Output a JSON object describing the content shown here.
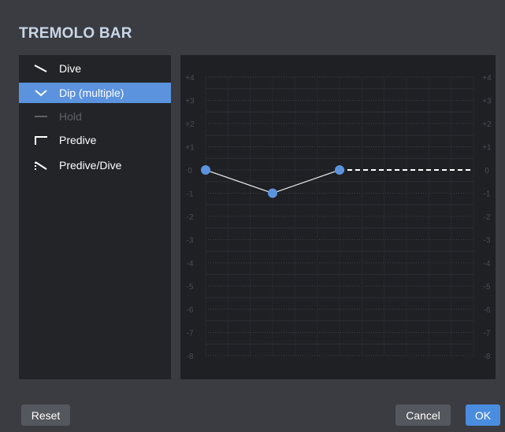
{
  "dialog": {
    "title": "TREMOLO BAR"
  },
  "types": [
    {
      "label": "Dive",
      "icon": "dive-icon",
      "selected": false,
      "disabled": false
    },
    {
      "label": "Dip (multiple)",
      "icon": "dip-icon",
      "selected": true,
      "disabled": false
    },
    {
      "label": "Hold",
      "icon": "hold-icon",
      "selected": false,
      "disabled": true
    },
    {
      "label": "Predive",
      "icon": "predive-icon",
      "selected": false,
      "disabled": false
    },
    {
      "label": "Predive/Dive",
      "icon": "predive-dive-icon",
      "selected": false,
      "disabled": false
    }
  ],
  "chart_data": {
    "type": "line",
    "y_ticks": [
      "+4",
      "+3",
      "+2",
      "+1",
      "0",
      "-1",
      "-2",
      "-3",
      "-4",
      "-5",
      "-6",
      "-7",
      "-8"
    ],
    "ylim": [
      -8,
      4
    ],
    "x_steps": 12,
    "series": [
      {
        "points": [
          [
            0,
            0
          ],
          [
            3,
            -1
          ],
          [
            6,
            0
          ]
        ]
      }
    ],
    "hold_line": {
      "from": [
        6,
        0
      ],
      "to": [
        12,
        0
      ],
      "style": "dashed"
    },
    "colors": {
      "point": "#5b93de",
      "line": "#e6e6e6",
      "hold": "#ffffff"
    }
  },
  "buttons": {
    "reset": "Reset",
    "cancel": "Cancel",
    "ok": "OK"
  }
}
